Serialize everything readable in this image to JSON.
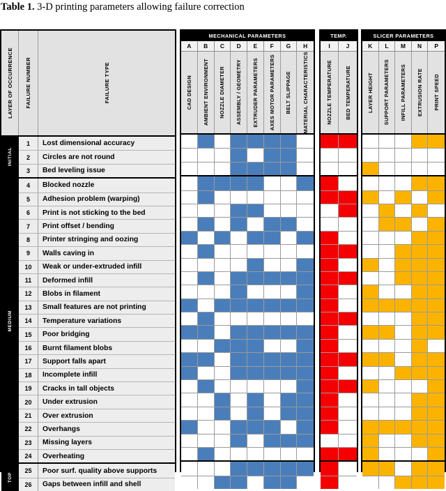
{
  "caption": {
    "label": "Table 1.",
    "text": " 3-D printing parameters allowing failure correction"
  },
  "colors": {
    "blue": "#4a7ebb",
    "red": "#f40000",
    "orange": "#fbb300",
    "header_band": "#000000",
    "header_fill": "#e2e2e2",
    "row_fill": "#ededed"
  },
  "left_headers": {
    "layer": "LAYER OF OCCURRENCE",
    "number": "FAILURE NUMBER",
    "type": "FAILURE TYPE"
  },
  "groups": [
    {
      "key": "mechanical",
      "title": "MECHANICAL PARAMETERS",
      "columns": [
        {
          "letter": "A",
          "name": "CAD DESIGN"
        },
        {
          "letter": "B",
          "name": "AMBIENT ENVIRONMENT"
        },
        {
          "letter": "C",
          "name": "NOZZLE DIAMETER"
        },
        {
          "letter": "D",
          "name": "ASSEMBLY / GEOMETRY"
        },
        {
          "letter": "E",
          "name": "EXTRUDER PARAMETERS"
        },
        {
          "letter": "F",
          "name": "AXES MOTOR PARAMETERS"
        },
        {
          "letter": "G",
          "name": "BELT SLIPPAGE"
        },
        {
          "letter": "H",
          "name": "MATERIAL CHARACTERISTICS"
        }
      ]
    },
    {
      "key": "temp",
      "title": "TEMP.",
      "columns": [
        {
          "letter": "I",
          "name": "NOZZLE TEMPERATURE"
        },
        {
          "letter": "J",
          "name": "BED TEMPERATURE"
        }
      ]
    },
    {
      "key": "slicer",
      "title": "SLICER PARAMETERS",
      "columns": [
        {
          "letter": "K",
          "name": "LAYER HEIGHT"
        },
        {
          "letter": "L",
          "name": "SUPPORT PARAMETERS"
        },
        {
          "letter": "M",
          "name": "INFILL PARAMETERS"
        },
        {
          "letter": "N",
          "name": "EXTRUSION RATE"
        },
        {
          "letter": "P",
          "name": "PRINT SPEED"
        }
      ]
    }
  ],
  "sections": [
    {
      "label": "INITIAL",
      "rows": [
        {
          "number": "1",
          "type": "Lost dimensional accuracy",
          "mechanical": [
            "",
            "blue",
            "",
            "blue",
            "blue",
            "blue",
            "blue",
            ""
          ],
          "temp": [
            "red",
            "red"
          ],
          "slicer": [
            "",
            "",
            "",
            "orange",
            "orange"
          ]
        },
        {
          "number": "2",
          "type": "Circles are not round",
          "mechanical": [
            "",
            "",
            "",
            "blue",
            "",
            "blue",
            "blue",
            ""
          ],
          "temp": [
            "",
            ""
          ],
          "slicer": [
            "",
            "",
            "",
            "",
            ""
          ]
        },
        {
          "number": "3",
          "type": "Bed leveling issue",
          "mechanical": [
            "",
            "",
            "",
            "blue",
            "blue",
            "blue",
            "blue",
            ""
          ],
          "temp": [
            "",
            ""
          ],
          "slicer": [
            "orange",
            "",
            "",
            "",
            ""
          ]
        }
      ]
    },
    {
      "label": "MEDIUM",
      "rows": [
        {
          "number": "4",
          "type": "Blocked nozzle",
          "mechanical": [
            "",
            "blue",
            "blue",
            "blue",
            "blue",
            "",
            "",
            "blue"
          ],
          "temp": [
            "red",
            ""
          ],
          "slicer": [
            "",
            "",
            "",
            "orange",
            "orange"
          ]
        },
        {
          "number": "5",
          "type": "Adhesion problem (warping)",
          "mechanical": [
            "",
            "blue",
            "",
            "",
            "",
            "",
            "",
            ""
          ],
          "temp": [
            "red",
            "red"
          ],
          "slicer": [
            "orange",
            "",
            "orange",
            "",
            "orange"
          ]
        },
        {
          "number": "6",
          "type": "Print is not sticking to the bed",
          "mechanical": [
            "",
            "",
            "",
            "blue",
            "blue",
            "",
            "",
            ""
          ],
          "temp": [
            "",
            "red"
          ],
          "slicer": [
            "",
            "orange",
            "",
            "orange",
            ""
          ]
        },
        {
          "number": "7",
          "type": "Print offset / bending",
          "mechanical": [
            "",
            "blue",
            "",
            "blue",
            "",
            "blue",
            "blue",
            ""
          ],
          "temp": [
            "",
            ""
          ],
          "slicer": [
            "",
            "orange",
            "orange",
            "",
            "orange"
          ]
        },
        {
          "number": "8",
          "type": "Printer stringing and oozing",
          "mechanical": [
            "blue",
            "",
            "blue",
            "",
            "blue",
            "blue",
            "",
            "blue"
          ],
          "temp": [
            "red",
            ""
          ],
          "slicer": [
            "",
            "",
            "",
            "orange",
            "orange"
          ]
        },
        {
          "number": "9",
          "type": "Walls caving in",
          "mechanical": [
            "",
            "blue",
            "",
            "",
            "",
            "",
            "",
            ""
          ],
          "temp": [
            "red",
            "red"
          ],
          "slicer": [
            "",
            "",
            "orange",
            "orange",
            "orange"
          ]
        },
        {
          "number": "10",
          "type": "Weak or under-extruded infill",
          "mechanical": [
            "",
            "",
            "",
            "",
            "blue",
            "",
            "",
            "blue"
          ],
          "temp": [
            "red",
            ""
          ],
          "slicer": [
            "orange",
            "",
            "orange",
            "orange",
            "orange"
          ]
        },
        {
          "number": "11",
          "type": "Deformed infill",
          "mechanical": [
            "",
            "blue",
            "",
            "blue",
            "blue",
            "blue",
            "blue",
            "blue"
          ],
          "temp": [
            "red",
            "red"
          ],
          "slicer": [
            "",
            "",
            "orange",
            "orange",
            "orange"
          ]
        },
        {
          "number": "12",
          "type": "Blobs in filament",
          "mechanical": [
            "",
            "",
            "",
            "blue",
            "",
            "",
            "",
            "blue"
          ],
          "temp": [
            "red",
            ""
          ],
          "slicer": [
            "orange",
            "",
            "",
            "orange",
            "orange"
          ]
        },
        {
          "number": "13",
          "type": "Small features are not printing",
          "mechanical": [
            "blue",
            "",
            "blue",
            "blue",
            "blue",
            "blue",
            "blue",
            "blue"
          ],
          "temp": [
            "red",
            ""
          ],
          "slicer": [
            "orange",
            "orange",
            "orange",
            "orange",
            "orange"
          ]
        },
        {
          "number": "14",
          "type": "Temperature variations",
          "mechanical": [
            "",
            "blue",
            "",
            "",
            "",
            "",
            "",
            ""
          ],
          "temp": [
            "red",
            "red"
          ],
          "slicer": [
            "",
            "",
            "",
            "orange",
            "orange"
          ]
        },
        {
          "number": "15",
          "type": "Poor bridging",
          "mechanical": [
            "blue",
            "blue",
            "",
            "blue",
            "blue",
            "blue",
            "blue",
            "blue"
          ],
          "temp": [
            "red",
            ""
          ],
          "slicer": [
            "orange",
            "orange",
            "",
            "orange",
            "orange"
          ]
        },
        {
          "number": "16",
          "type": "Burnt filament blobs",
          "mechanical": [
            "",
            "",
            "blue",
            "blue",
            "blue",
            "",
            "",
            "blue"
          ],
          "temp": [
            "red",
            ""
          ],
          "slicer": [
            "",
            "",
            "",
            "orange",
            ""
          ]
        },
        {
          "number": "17",
          "type": "Support falls apart",
          "mechanical": [
            "blue",
            "blue",
            "",
            "blue",
            "blue",
            "blue",
            "blue",
            "blue"
          ],
          "temp": [
            "red",
            "red"
          ],
          "slicer": [
            "orange",
            "orange",
            "",
            "orange",
            "orange"
          ]
        },
        {
          "number": "18",
          "type": "Incomplete infill",
          "mechanical": [
            "blue",
            "",
            "",
            "blue",
            "blue",
            "blue",
            "blue",
            "blue"
          ],
          "temp": [
            "red",
            ""
          ],
          "slicer": [
            "",
            "",
            "orange",
            "orange",
            "orange"
          ]
        },
        {
          "number": "19",
          "type": "Cracks in tall objects",
          "mechanical": [
            "",
            "blue",
            "",
            "",
            "",
            "",
            "",
            "blue"
          ],
          "temp": [
            "red",
            "red"
          ],
          "slicer": [
            "orange",
            "",
            "",
            "",
            "orange"
          ]
        },
        {
          "number": "20",
          "type": "Under extrusion",
          "mechanical": [
            "",
            "",
            "blue",
            "",
            "blue",
            "",
            "blue",
            "blue"
          ],
          "temp": [
            "red",
            ""
          ],
          "slicer": [
            "",
            "",
            "",
            "orange",
            "orange"
          ]
        },
        {
          "number": "21",
          "type": "Over extrusion",
          "mechanical": [
            "",
            "",
            "blue",
            "",
            "blue",
            "",
            "blue",
            "blue"
          ],
          "temp": [
            "red",
            ""
          ],
          "slicer": [
            "",
            "",
            "",
            "orange",
            "orange"
          ]
        },
        {
          "number": "22",
          "type": "Overhangs",
          "mechanical": [
            "blue",
            "",
            "",
            "blue",
            "blue",
            "blue",
            "",
            "blue"
          ],
          "temp": [
            "red",
            ""
          ],
          "slicer": [
            "orange",
            "orange",
            "orange",
            "orange",
            "orange"
          ]
        },
        {
          "number": "23",
          "type": "Missing layers",
          "mechanical": [
            "",
            "",
            "",
            "blue",
            "",
            "blue",
            "blue",
            "blue"
          ],
          "temp": [
            "",
            ""
          ],
          "slicer": [
            "orange",
            "",
            "",
            "orange",
            "orange"
          ]
        },
        {
          "number": "24",
          "type": "Overheating",
          "mechanical": [
            "",
            "blue",
            "",
            "",
            "",
            "",
            "",
            ""
          ],
          "temp": [
            "red",
            "red"
          ],
          "slicer": [
            "orange",
            "",
            "",
            "",
            "orange"
          ]
        }
      ]
    },
    {
      "label": "TOP",
      "rows": [
        {
          "number": "25",
          "type": "Poor surf. quality above supports",
          "mechanical": [
            "",
            "",
            "",
            "blue",
            "blue",
            "blue",
            "blue",
            "blue"
          ],
          "temp": [
            "red",
            ""
          ],
          "slicer": [
            "orange",
            "orange",
            "",
            "orange",
            "orange"
          ]
        },
        {
          "number": "26",
          "type": "Gaps between infill and shell",
          "mechanical": [
            "",
            "",
            "blue",
            "blue",
            "",
            "blue",
            "blue",
            ""
          ],
          "temp": [
            "red",
            ""
          ],
          "slicer": [
            "",
            "",
            "orange",
            "orange",
            "orange"
          ]
        }
      ]
    }
  ]
}
